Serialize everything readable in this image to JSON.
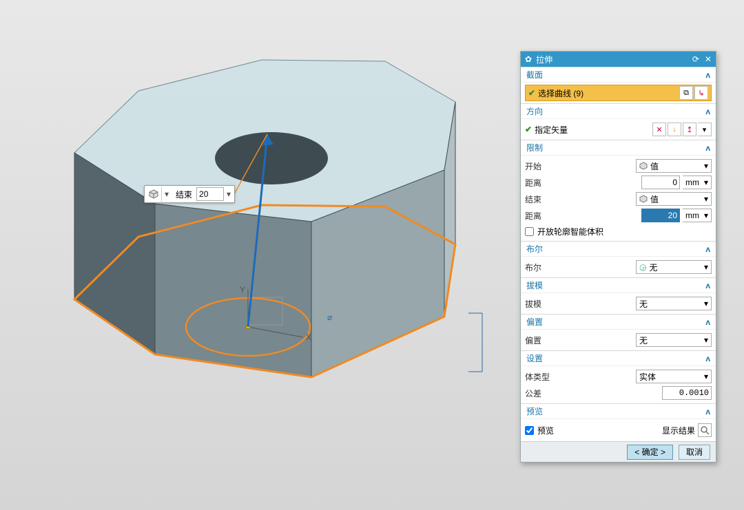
{
  "float": {
    "field_label": "结束",
    "value": "20",
    "icon": "cube-icon"
  },
  "panel": {
    "title": "拉伸",
    "title_icon": "gear-icon",
    "sections": {
      "section_profile": {
        "header": "截面",
        "select_curve": "选择曲线 (9)"
      },
      "direction": {
        "header": "方向",
        "specify_vector": "指定矢量"
      },
      "limit": {
        "header": "限制",
        "start_label": "开始",
        "start_mode": "值",
        "start_dist_label": "距离",
        "start_dist_value": "0",
        "start_unit": "mm",
        "end_label": "结束",
        "end_mode": "值",
        "end_dist_label": "距离",
        "end_dist_value": "20",
        "end_unit": "mm",
        "open_profile": "开放轮廓智能体积"
      },
      "boolean": {
        "header": "布尔",
        "label": "布尔",
        "value": "无"
      },
      "draft": {
        "header": "拔模",
        "label": "拔模",
        "value": "无"
      },
      "offset": {
        "header": "偏置",
        "label": "偏置",
        "value": "无"
      },
      "settings": {
        "header": "设置",
        "body_type_label": "体类型",
        "body_type_value": "实体",
        "tolerance_label": "公差",
        "tolerance_value": "0.0010"
      },
      "preview": {
        "header": "预览",
        "checkbox_label": "预览",
        "show_result": "显示结果"
      }
    },
    "footer": {
      "ok": "< 确定 >",
      "cancel": "取消"
    }
  }
}
